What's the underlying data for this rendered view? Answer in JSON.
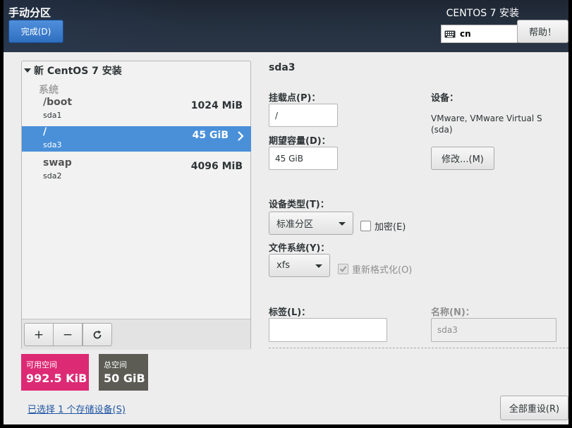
{
  "header": {
    "title": "手动分区",
    "done_label": "完成(D)",
    "product_title": "CENTOS 7 安装",
    "keyboard_layout": "cn",
    "help_label": "帮助！"
  },
  "left_panel": {
    "install_title": "新 CentOS 7 安装",
    "group_label": "系统",
    "mounts": [
      {
        "mount_point": "/boot",
        "device": "sda1",
        "size": "1024 MiB",
        "selected": false
      },
      {
        "mount_point": "/",
        "device": "sda3",
        "size": "45 GiB",
        "selected": true
      },
      {
        "mount_point": "swap",
        "device": "sda2",
        "size": "4096 MiB",
        "selected": false
      }
    ],
    "toolbar": {
      "add": "+",
      "remove": "−"
    }
  },
  "space": {
    "available_label": "可用空间",
    "available_value": "992.5 KiB",
    "total_label": "总空间",
    "total_value": "50 GiB",
    "available_color": "#dd2a74",
    "total_color": "#5c5c55"
  },
  "storage_link": "已选择 1 个存储设备(S)",
  "detail": {
    "title": "sda3",
    "mount_point_label": "挂载点(P)：",
    "mount_point_value": "/",
    "capacity_label": "期望容量(D)：",
    "capacity_value": "45 GiB",
    "device_heading": "设备：",
    "device_name": "VMware, VMware Virtual S",
    "device_id": "(sda)",
    "modify_label": "修改...(M)",
    "device_type_label": "设备类型(T)：",
    "device_type_value": "标准分区",
    "encrypt_label": "加密(E)",
    "filesystem_label": "文件系统(Y)：",
    "filesystem_value": "xfs",
    "reformat_label": "重新格式化(O)",
    "tag_label": "标签(L)：",
    "tag_value": "",
    "name_label": "名称(N)：",
    "name_value": "sda3"
  },
  "reset_all_label": "全部重设(R)",
  "icons": {
    "keyboard": "keyboard-icon",
    "reload": "reload-icon",
    "chevron": "chevron-right-icon",
    "expander": "triangle-down-icon"
  }
}
